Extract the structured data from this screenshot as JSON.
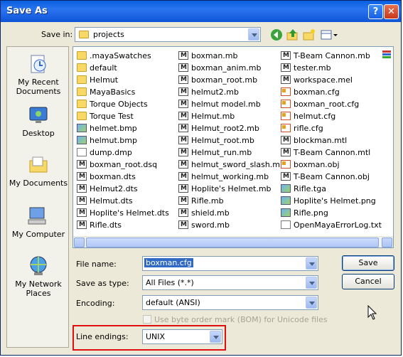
{
  "window": {
    "title": "Save As",
    "help_glyph": "?",
    "close_glyph": "✕"
  },
  "toolbar": {
    "save_in_label": "Save in:",
    "location": "projects",
    "icons": [
      "back-icon",
      "up-folder-icon",
      "new-folder-icon",
      "views-menu-icon"
    ]
  },
  "places": [
    {
      "label": "My Recent Documents",
      "icon": "recent-documents-icon"
    },
    {
      "label": "Desktop",
      "icon": "desktop-icon"
    },
    {
      "label": "My Documents",
      "icon": "my-documents-icon"
    },
    {
      "label": "My Computer",
      "icon": "my-computer-icon"
    },
    {
      "label": "My Network Places",
      "icon": "network-places-icon"
    }
  ],
  "files": {
    "col1": [
      {
        "name": ".mayaSwatches",
        "type": "folder"
      },
      {
        "name": "default",
        "type": "folder"
      },
      {
        "name": "Helmut",
        "type": "folder"
      },
      {
        "name": "MayaBasics",
        "type": "folder"
      },
      {
        "name": "Torque Objects",
        "type": "folder"
      },
      {
        "name": "Torque Test",
        "type": "folder"
      },
      {
        "name": "helmet.bmp",
        "type": "img"
      },
      {
        "name": "helmut.bmp",
        "type": "img"
      },
      {
        "name": "dump.dmp",
        "type": "doc"
      },
      {
        "name": "boxman_root.dsq",
        "type": "maya"
      },
      {
        "name": "boxman.dts",
        "type": "maya"
      },
      {
        "name": "Helmut2.dts",
        "type": "maya"
      },
      {
        "name": "Helmut.dts",
        "type": "maya"
      },
      {
        "name": "Hoplite's Helmet.dts",
        "type": "maya"
      },
      {
        "name": "Rifle.dts",
        "type": "maya"
      }
    ],
    "col2": [
      {
        "name": "boxman.mb",
        "type": "maya"
      },
      {
        "name": "boxman_anim.mb",
        "type": "maya"
      },
      {
        "name": "boxman_root.mb",
        "type": "maya"
      },
      {
        "name": "helmut2.mb",
        "type": "maya"
      },
      {
        "name": "helmut model.mb",
        "type": "maya"
      },
      {
        "name": "Helmut.mb",
        "type": "maya"
      },
      {
        "name": "Helmut_root2.mb",
        "type": "maya"
      },
      {
        "name": "Helmut_root.mb",
        "type": "maya"
      },
      {
        "name": "Helmut_run.mb",
        "type": "maya"
      },
      {
        "name": "helmut_sword_slash.mb",
        "type": "maya"
      },
      {
        "name": "helmut_working.mb",
        "type": "maya"
      },
      {
        "name": "Hoplite's Helmet.mb",
        "type": "maya"
      },
      {
        "name": "Rifle.mb",
        "type": "maya"
      },
      {
        "name": "shield.mb",
        "type": "maya"
      },
      {
        "name": "sword.mb",
        "type": "maya"
      }
    ],
    "col3": [
      {
        "name": "T-Beam Cannon.mb",
        "type": "maya"
      },
      {
        "name": "tester.mb",
        "type": "maya"
      },
      {
        "name": "workspace.mel",
        "type": "maya"
      },
      {
        "name": "boxman.cfg",
        "type": "cfg"
      },
      {
        "name": "boxman_root.cfg",
        "type": "cfg"
      },
      {
        "name": "helmut.cfg",
        "type": "cfg"
      },
      {
        "name": "rifle.cfg",
        "type": "cfg"
      },
      {
        "name": "blockman.mtl",
        "type": "maya"
      },
      {
        "name": "T-Beam Cannon.mtl",
        "type": "maya"
      },
      {
        "name": "boxman.obj",
        "type": "cfg"
      },
      {
        "name": "T-Beam Cannon.obj",
        "type": "maya"
      },
      {
        "name": "Rifle.tga",
        "type": "img"
      },
      {
        "name": "Hoplite's Helmet.png",
        "type": "img"
      },
      {
        "name": "Rifle.png",
        "type": "img"
      },
      {
        "name": "OpenMayaErrorLog.txt",
        "type": "doc"
      }
    ]
  },
  "form": {
    "file_name_label": "File name:",
    "file_name_value": "boxman.cfg",
    "save_as_type_label": "Save as type:",
    "save_as_type_value": "All Files (*.*)",
    "encoding_label": "Encoding:",
    "encoding_value": "default (ANSI)",
    "bom_label": "Use byte order mark (BOM) for Unicode files",
    "line_endings_label": "Line endings:",
    "line_endings_value": "UNIX"
  },
  "buttons": {
    "save": "Save",
    "cancel": "Cancel"
  }
}
